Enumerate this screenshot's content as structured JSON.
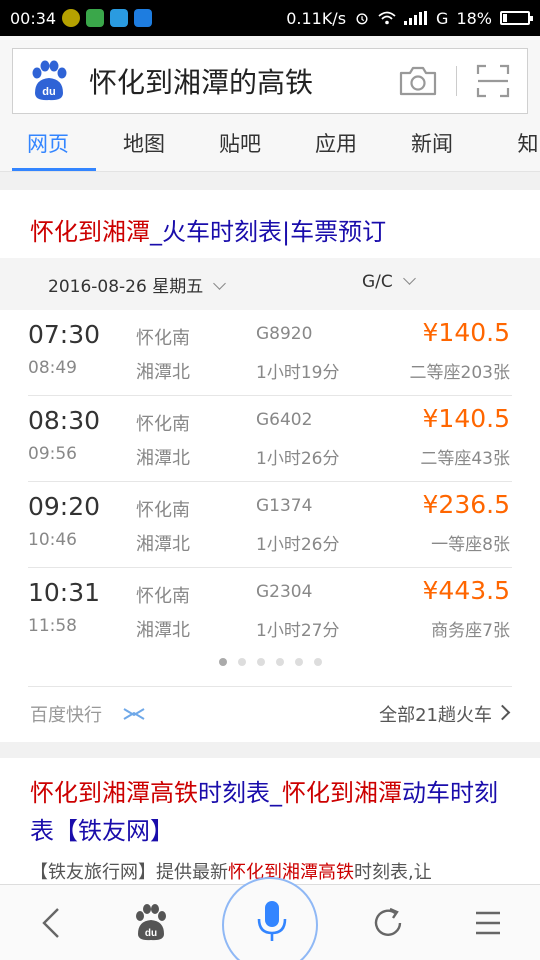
{
  "status_bar": {
    "time": "00:34",
    "speed": "0.11K/s",
    "network": "G",
    "battery": "18%",
    "battery_level": 0.18,
    "app_icon_colors": [
      "#b5a100",
      "#3aa74a",
      "#2a9be0",
      "#1e7de0"
    ]
  },
  "search": {
    "query": "怀化到湘潭的高铁",
    "logo_icon": "baidu-paw-icon",
    "camera_icon": "camera-icon",
    "scan_icon": "scan-icon"
  },
  "tabs": [
    {
      "label": "网页",
      "active": true
    },
    {
      "label": "地图",
      "active": false
    },
    {
      "label": "贴吧",
      "active": false
    },
    {
      "label": "应用",
      "active": false
    },
    {
      "label": "新闻",
      "active": false
    },
    {
      "label": "知",
      "active": false
    }
  ],
  "result1": {
    "title_hl": "怀化到湘潭",
    "title_rest": "_火车时刻表|车票预订",
    "filter_date": "2016-08-26 星期五",
    "filter_type": "G/C",
    "trains": [
      {
        "dep": "07:30",
        "arr": "08:49",
        "from": "怀化南",
        "to": "湘潭北",
        "no": "G8920",
        "dur": "1小时19分",
        "price": "¥140.5",
        "seat": "二等座203张"
      },
      {
        "dep": "08:30",
        "arr": "09:56",
        "from": "怀化南",
        "to": "湘潭北",
        "no": "G6402",
        "dur": "1小时26分",
        "price": "¥140.5",
        "seat": "二等座43张"
      },
      {
        "dep": "09:20",
        "arr": "10:46",
        "from": "怀化南",
        "to": "湘潭北",
        "no": "G1374",
        "dur": "1小时26分",
        "price": "¥236.5",
        "seat": "一等座8张"
      },
      {
        "dep": "10:31",
        "arr": "11:58",
        "from": "怀化南",
        "to": "湘潭北",
        "no": "G2304",
        "dur": "1小时27分",
        "price": "¥443.5",
        "seat": "商务座7张"
      }
    ],
    "page_dots": 6,
    "active_dot": 0,
    "source": "百度快行",
    "all_link": "全部21趟火车"
  },
  "result2": {
    "t1": "怀化到湘潭高铁",
    "t2": "时刻表_",
    "t3": "怀化到湘潭",
    "t4": "动车时刻表【铁友网】",
    "s1": "【铁友旅行网】提供最新",
    "s2": "怀化到湘潭高铁",
    "s3": "时刻表,让"
  },
  "colors": {
    "accent": "#3385ff",
    "highlight": "#cc0000",
    "link": "#1a0dab",
    "price": "#ff6600"
  },
  "bottom_nav": [
    "back-icon",
    "baidu-paw-icon",
    "microphone-icon",
    "refresh-icon",
    "menu-icon"
  ]
}
